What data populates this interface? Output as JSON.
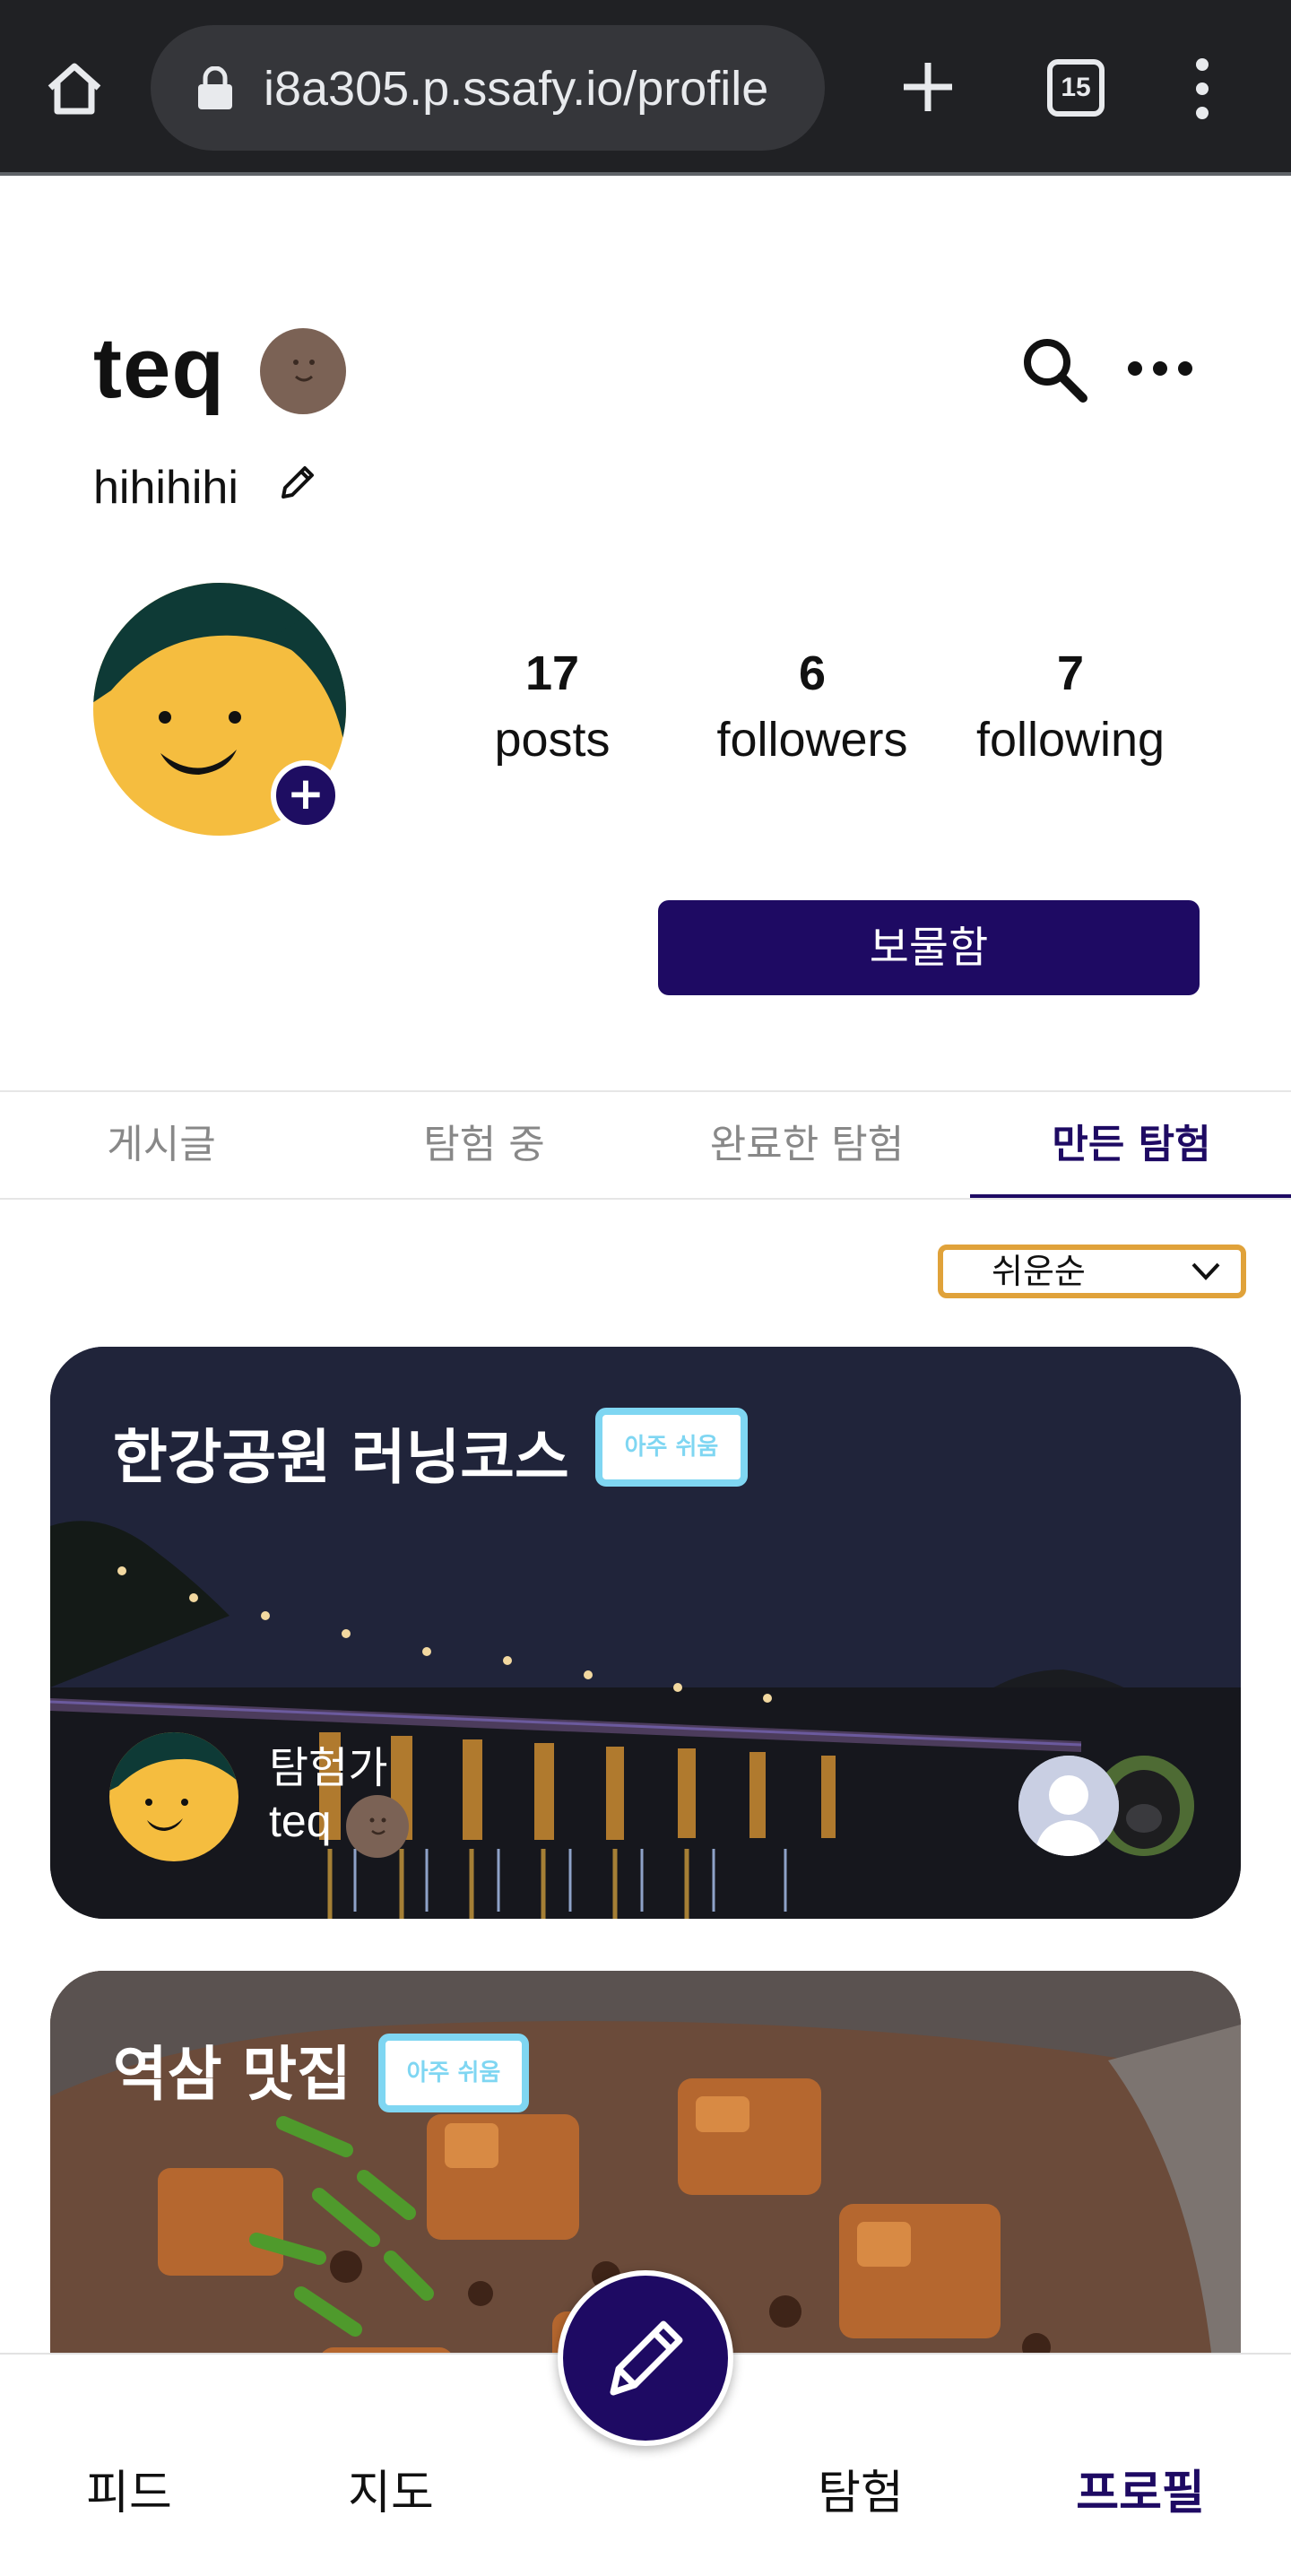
{
  "browser": {
    "url": "i8a305.p.ssafy.io/profile",
    "tab_count": "15"
  },
  "profile": {
    "username": "teq",
    "bio": "hihihihi",
    "stats": [
      {
        "value": "17",
        "label": "posts"
      },
      {
        "value": "6",
        "label": "followers"
      },
      {
        "value": "7",
        "label": "following"
      }
    ],
    "treasure_button": "보물함",
    "avatar_plus": "+"
  },
  "tabs": [
    "게시글",
    "탐험 중",
    "완료한 탐험",
    "만든 탐험"
  ],
  "active_tab": "만든 탐험",
  "sort": {
    "selected": "쉬운순"
  },
  "cards": [
    {
      "title": "한강공원 러닝코스",
      "difficulty": "아주 쉬움",
      "explorer_label": "탐험가",
      "explorer_name": "teq"
    },
    {
      "title": "역삼 맛집",
      "difficulty": "아주 쉬움"
    }
  ],
  "bottom_nav": {
    "items": [
      "피드",
      "지도",
      "탐험",
      "프로필"
    ],
    "active": "프로필"
  },
  "colors": {
    "brand": "#1e0a63",
    "badge": "#7fd6f2",
    "sort_border": "#e0a23a",
    "avatar_yellow": "#f5bd3f",
    "avatar_hat": "#0e3a36"
  }
}
